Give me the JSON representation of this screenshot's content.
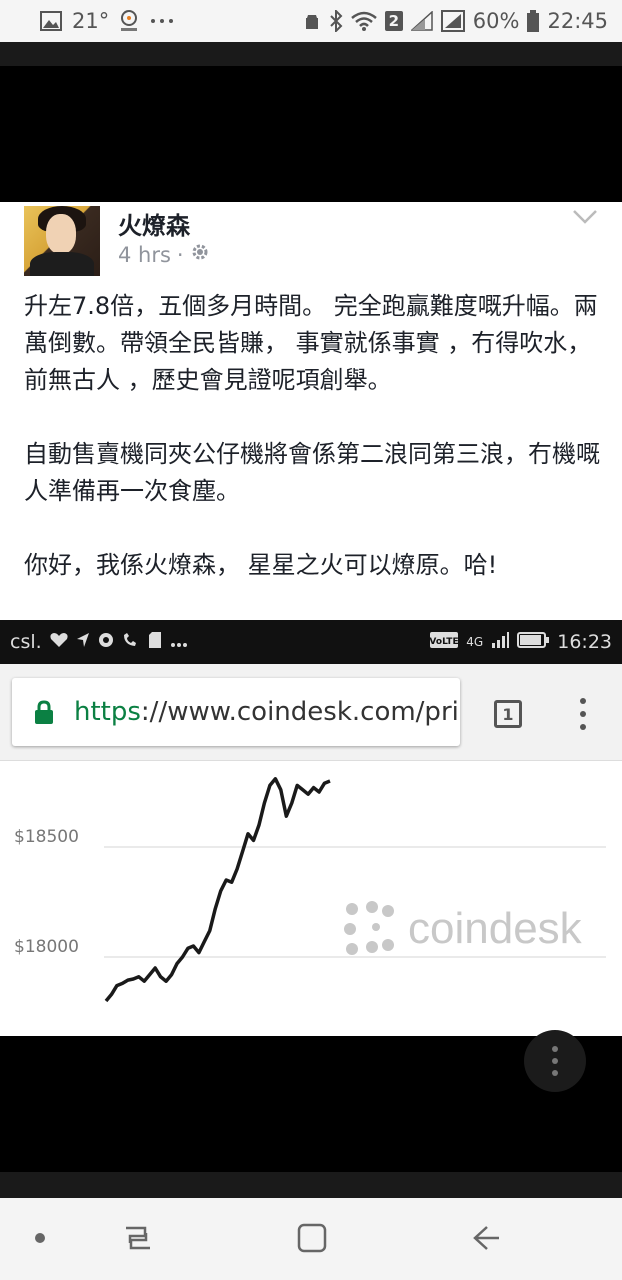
{
  "status_bar": {
    "temperature": "21°",
    "notification_count": "2",
    "battery": "60%",
    "time": "22:45",
    "icons": [
      "image-icon",
      "weather-icon",
      "more-notifications-icon",
      "recycle-icon",
      "bluetooth-icon",
      "wifi-icon",
      "sim-icon",
      "signal-icon",
      "battery-icon"
    ]
  },
  "post": {
    "author": "火燎森",
    "time": "4 hrs",
    "separator": "·",
    "paragraphs": [
      "升左7.8倍，五個多月時間。 完全跑贏難度嘅升幅。兩萬倒數。帶領全民皆賺， 事實就係事實 ，冇得吹水， 前無古人 ，歷史會見證呢項創舉。",
      "自動售賣機同夾公仔機將會係第二浪同第三浪，冇機嘅人準備再一次食塵。",
      "你好，我係火燎森， 星星之火可以燎原。哈!"
    ]
  },
  "embedded": {
    "carrier": "csl.",
    "network": "4G",
    "time": "16:23",
    "url_scheme": "https",
    "url_rest": "://www.coindesk.com/pri",
    "tab_count": "1",
    "watermark": "coindesk",
    "accent_color": "#0b8043"
  },
  "chart_data": {
    "type": "line",
    "title": "",
    "xlabel": "",
    "ylabel": "",
    "yticks": [
      "$18500",
      "$18000"
    ],
    "ylim": [
      17750,
      18850
    ],
    "series": [
      {
        "values": [
          17800,
          17830,
          17870,
          17880,
          17895,
          17900,
          17910,
          17890,
          17920,
          17950,
          17910,
          17890,
          17920,
          17970,
          18000,
          18040,
          18050,
          18020,
          18070,
          18120,
          18220,
          18300,
          18350,
          18340,
          18400,
          18480,
          18560,
          18530,
          18600,
          18700,
          18780,
          18810,
          18760,
          18640,
          18700,
          18780,
          18760,
          18740,
          18770,
          18750,
          18790,
          18800
        ]
      }
    ]
  },
  "nav": {
    "icons": [
      "dot-icon",
      "recent-apps-icon",
      "home-icon",
      "back-icon"
    ]
  }
}
